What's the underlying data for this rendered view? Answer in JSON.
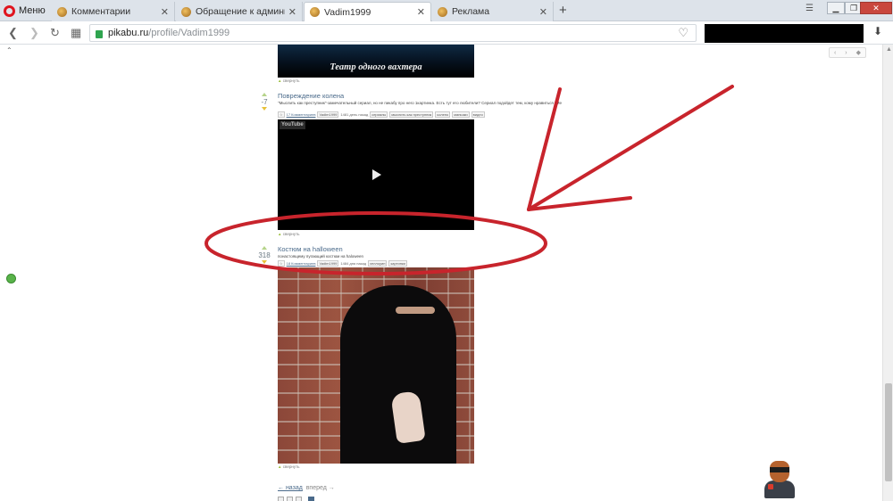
{
  "browser": {
    "menu_label": "Меню",
    "tabs": [
      {
        "title": "Комментарии",
        "active": false
      },
      {
        "title": "Обращение к администр",
        "active": false
      },
      {
        "title": "Vadim1999",
        "active": true
      },
      {
        "title": "Реклама",
        "active": false
      }
    ],
    "url_host": "pikabu.ru",
    "url_path": "/profile/Vadim1999",
    "accent_color": "#e0141e"
  },
  "feed": {
    "video_post": {
      "video_title": "Театр одного вахтера",
      "collapse_label": "свернуть"
    },
    "post1": {
      "title": "Повреждение колена",
      "rating": "-7",
      "description": "\"Мыслить как преступник\"-замечательный сериал, но не пикабу про него 1картинка. Есть тут его любители? Сериал подойдет тем, кому нравиться \"Ме",
      "comments": "17 Комментариев",
      "author": "Vadim1999",
      "age": "1481 день назад",
      "tags": [
        "сериалы",
        "мыслить как преступник",
        "колено",
        "маньяки",
        "видео"
      ],
      "video_logo": "YouTube",
      "collapse_label": "свернуть"
    },
    "post2": {
      "title": "Костюм на halloween",
      "rating": "318",
      "description": "понастоящему пугающий костюм на haloween",
      "comments": "18 Комментариев",
      "author": "Vadim1999",
      "age": "1484 дня назад",
      "tags": [
        "хеллоуин",
        "картинки"
      ],
      "collapse_label": "свернуть"
    },
    "pager": {
      "back": "← назад",
      "forward": "вперед →"
    }
  },
  "annotation": {
    "color": "#c8242c"
  }
}
